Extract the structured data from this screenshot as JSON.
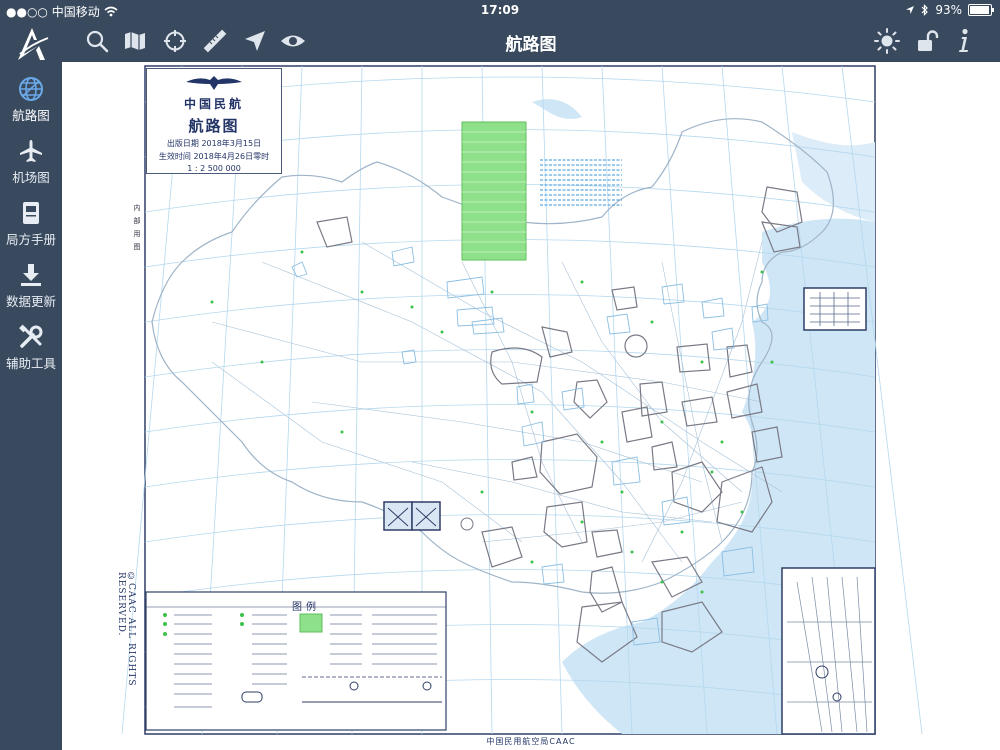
{
  "status_bar": {
    "carrier": "●●○○ 中国移动",
    "time": "17:09",
    "battery": "93%",
    "battery_level": 0.93
  },
  "sidebar": {
    "logo_icon": "app-logo-a-icon",
    "items": [
      {
        "label": "航路图",
        "icon": "globe-icon",
        "active": true
      },
      {
        "label": "机场图",
        "icon": "airplane-icon",
        "active": false
      },
      {
        "label": "局方手册",
        "icon": "book-icon",
        "active": false
      },
      {
        "label": "数据更新",
        "icon": "download-icon",
        "active": false
      },
      {
        "label": "辅助工具",
        "icon": "tools-icon",
        "active": false
      }
    ]
  },
  "toolbar": {
    "title": "航路图",
    "left_tools": [
      "search-icon",
      "map-icon",
      "crosshair-icon",
      "ruler-icon",
      "location-arrow-icon",
      "eye-icon"
    ],
    "right_tools": [
      "brightness-icon",
      "unlock-icon",
      "info-icon"
    ]
  },
  "chart": {
    "org_cn": "中国民航",
    "name": "航路图",
    "publish_date": "出版日期 2018年3月15日",
    "effective": "生效时间 2018年4月26日零时",
    "scale": "1 : 2 500 000",
    "side_note": "内部用图",
    "copyright": "©CAAC ALL RIGHTS RESERVED.",
    "legend_title": "图例",
    "footer": "中国民用航空局CAAC"
  },
  "colors": {
    "chrome": "#39495e",
    "sea": "#cfe6f6",
    "grid": "#b5d8ee",
    "airspace": "#7a7a86",
    "restricted_green": "#6fd46a"
  }
}
